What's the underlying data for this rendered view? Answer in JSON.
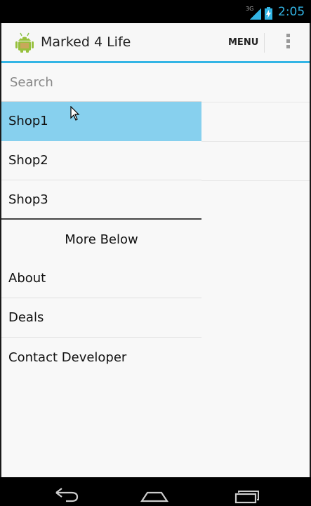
{
  "status_bar": {
    "network": "3G",
    "time": "2:05",
    "accent_color": "#33b5e5"
  },
  "action_bar": {
    "app_icon": "android-robot-icon",
    "title": "Marked 4 Life",
    "menu_label": "MENU",
    "overflow_icon": "overflow-vertical-icon"
  },
  "drawer": {
    "search_placeholder": "Search",
    "search_value": "",
    "shops": [
      {
        "label": "Shop1",
        "selected": true
      },
      {
        "label": "Shop2",
        "selected": false
      },
      {
        "label": "Shop3",
        "selected": false
      }
    ],
    "section_label": "More Below",
    "links": [
      {
        "label": "About"
      },
      {
        "label": "Deals"
      },
      {
        "label": "Contact Developer"
      }
    ],
    "selected_color": "#87d0ee"
  },
  "nav_bar": {
    "back_icon": "back-icon",
    "home_icon": "home-icon",
    "recent_icon": "recent-apps-icon"
  }
}
